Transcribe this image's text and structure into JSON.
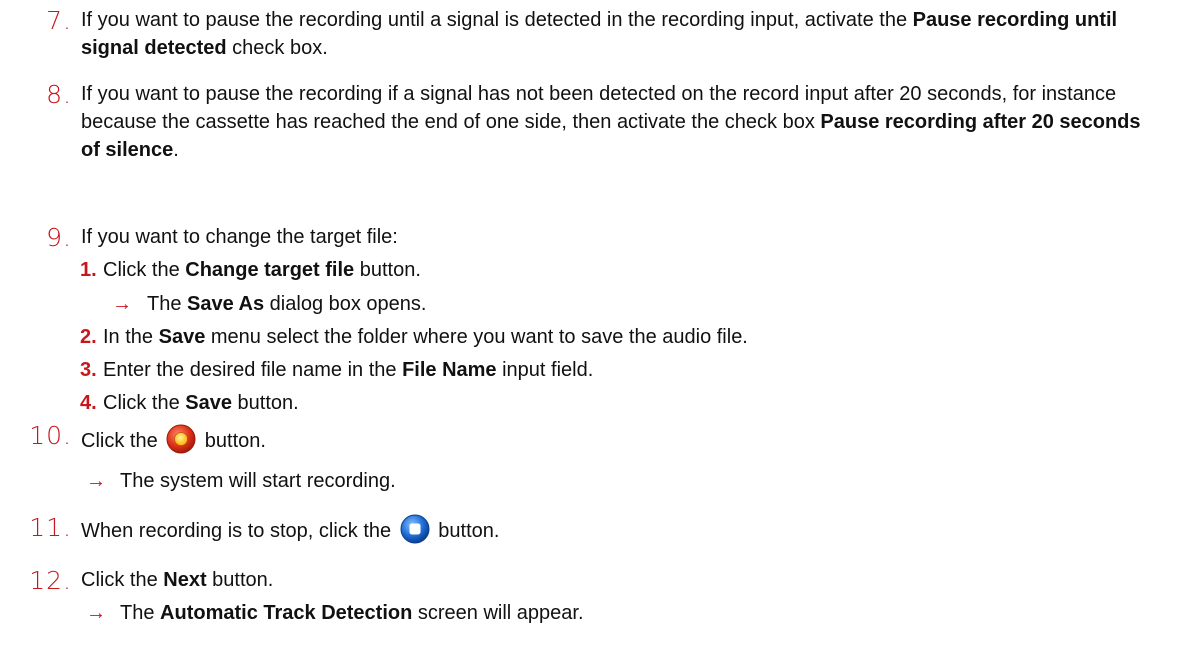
{
  "steps": {
    "s7": {
      "num": "7.",
      "t1": "If you want to pause the recording until a signal is detected in the recording input, activate the ",
      "b1": "Pause recording until signal detected",
      "t2": " check box."
    },
    "s8": {
      "num": "8.",
      "t1": "If you want to pause the recording if a signal has not been detected on the record input after 20 seconds, for instance because the cassette has reached the end of one side, then activate the check box ",
      "b1": "Pause recording after 20 seconds of silence",
      "t2": "."
    },
    "s9": {
      "num": "9.",
      "t1": "If you want to change the target file:",
      "subs": [
        {
          "num": "1.",
          "t1": "Click the ",
          "b1": "Change target file",
          "t2": " button."
        },
        {
          "num": "2.",
          "t1": "In the ",
          "b1": "Save",
          "t2": " menu select the folder where you want to save the audio file."
        },
        {
          "num": "3.",
          "t1": "Enter the desired file name in the ",
          "b1": "File Name",
          "t2": " input field."
        },
        {
          "num": "4.",
          "t1": "Click the ",
          "b1": "Save",
          "t2": " button."
        }
      ],
      "result1": {
        "arrow": "→",
        "t1": "The ",
        "b1": "Save As",
        "t2": " dialog box opens."
      }
    },
    "s10": {
      "num": "10.",
      "t1": "Click the ",
      "t2": " button.",
      "icon": "record-button-icon",
      "result": {
        "arrow": "→",
        "t1": "The system will start recording."
      }
    },
    "s11": {
      "num": "11.",
      "t1": "When recording is to stop, click the ",
      "t2": " button.",
      "icon": "stop-button-icon"
    },
    "s12": {
      "num": "12.",
      "t1": "Click the ",
      "b1": "Next",
      "t2": " button.",
      "result": {
        "arrow": "→",
        "t1": "The ",
        "b1": "Automatic Track Detection",
        "t2": " screen will appear."
      }
    }
  },
  "colors": {
    "accent": "#c8161d",
    "record": "#d9341e",
    "stop": "#1f6fd6"
  }
}
